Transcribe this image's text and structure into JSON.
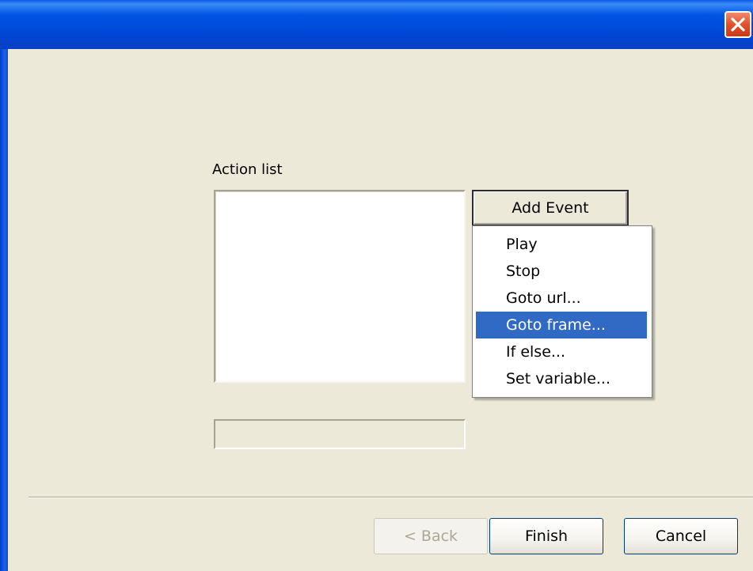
{
  "window": {
    "close_icon": "close-icon"
  },
  "action_list": {
    "label": "Action list",
    "items": []
  },
  "add_event_button": {
    "label": "Add Event"
  },
  "context_menu": {
    "items": [
      {
        "label": "Play"
      },
      {
        "label": "Stop"
      },
      {
        "label": "Goto url..."
      },
      {
        "label": "Goto frame..."
      },
      {
        "label": "If else..."
      },
      {
        "label": "Set variable..."
      }
    ],
    "selected": "Goto frame..."
  },
  "buttons": {
    "back": "< Back",
    "finish": "Finish",
    "cancel": "Cancel"
  },
  "colors": {
    "titlebar": "#0054e3",
    "dialog_bg": "#ece9d8",
    "selection": "#316ac5",
    "close_button": "#e2502c"
  }
}
